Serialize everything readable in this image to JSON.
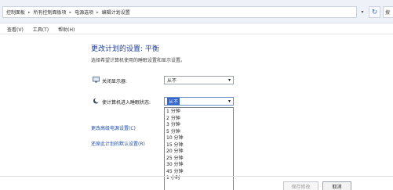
{
  "breadcrumb": {
    "items": [
      "控制面板",
      "所有控制面板项",
      "电源选项",
      "编辑计划设置"
    ],
    "separator": "▸",
    "dropdown_glyph": "▾",
    "refresh_glyph": "↻",
    "search_partial": "搜"
  },
  "menu": [
    "查看(V)",
    "工具(T)",
    "帮助(H)"
  ],
  "page": {
    "title": "更改计划的设置: 平衡",
    "subtitle": "选择希望计算机使用的睡眠设置和显示设置。"
  },
  "display_off": {
    "label": "关闭显示器:",
    "value": "从不",
    "icon": "monitor-icon"
  },
  "sleep": {
    "label": "使计算机进入睡眠状态:",
    "value": "从不",
    "icon": "moon-icon",
    "options": [
      "1 分钟",
      "2 分钟",
      "3 分钟",
      "5 分钟",
      "10 分钟",
      "15 分钟",
      "20 分钟",
      "25 分钟",
      "30 分钟",
      "45 分钟",
      "1 小时"
    ]
  },
  "links": {
    "advanced": "更改高级电源设置(C)",
    "restore": "还原此计划的默认设置(R)"
  },
  "buttons": {
    "save": "保存修改",
    "cancel": "取消"
  },
  "colors": {
    "title": "#1d3f9a",
    "link": "#1d4fb0",
    "selection": "#3366cc"
  }
}
